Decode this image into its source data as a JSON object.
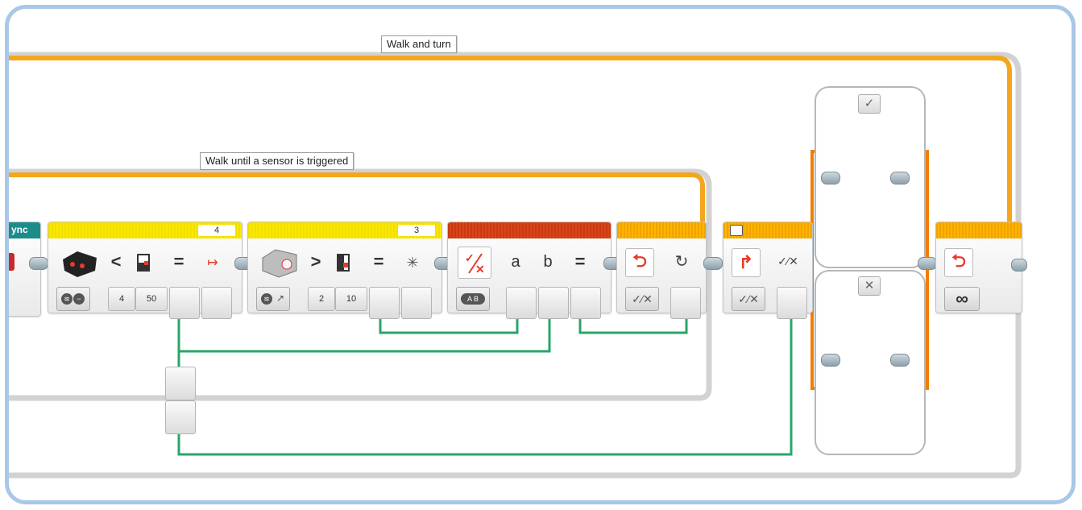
{
  "loops": {
    "outer_label": "Walk and turn",
    "inner_label": "Walk until a sensor is triggered"
  },
  "blocks": {
    "move_sync": {
      "label": "ync"
    },
    "ir_compare": {
      "port": "4",
      "operator": "<",
      "equals": "=",
      "input1": "4",
      "input2": "50"
    },
    "color_compare": {
      "port": "3",
      "operator": ">",
      "equals": "=",
      "input1": "2",
      "input2": "10"
    },
    "logic": {
      "a": "a",
      "b": "b",
      "equals": "=",
      "mode": "A B"
    },
    "loop_interrupt": {},
    "switch": {
      "true_case": "✓",
      "false_case": "✕"
    },
    "loop_end": {
      "mode_symbol": "∞"
    }
  },
  "colors": {
    "loop_orange": "#f4a61d",
    "loop_grey": "#d0d0d0",
    "wire_green": "#2aa56a",
    "sensor_yellow": "#fbe800",
    "logic_red": "#d8451a",
    "flow_orange": "#ffb400",
    "move_teal": "#1b8c8a",
    "frame_blue": "#a9c7e6"
  }
}
